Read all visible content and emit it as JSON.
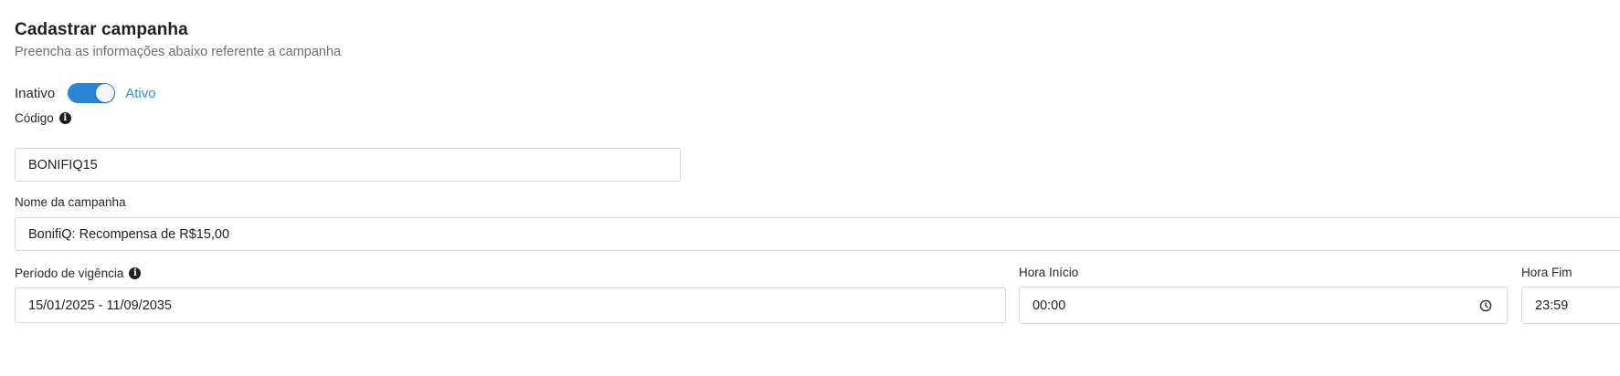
{
  "header": {
    "title": "Cadastrar campanha",
    "subtitle": "Preencha as informações abaixo referente a campanha"
  },
  "status": {
    "off_label": "Inativo",
    "on_label": "Ativo",
    "active": true,
    "toggle_color": "#2b86d8",
    "on_label_color": "#1a9ad6"
  },
  "form": {
    "code": {
      "label": "Código",
      "value": "BONIFIQ15",
      "info_icon": "info-icon"
    },
    "campaign_name": {
      "label": "Nome da campanha",
      "value": "BonifiQ: Recompensa de R$15,00"
    },
    "validity_period": {
      "label": "Período de vigência",
      "value": "15/01/2025 - 11/09/2035",
      "info_icon": "info-icon"
    },
    "start_time": {
      "label": "Hora Início",
      "value": "00:00",
      "icon": "clock-icon"
    },
    "end_time": {
      "label": "Hora Fim",
      "value": "23:59"
    }
  }
}
